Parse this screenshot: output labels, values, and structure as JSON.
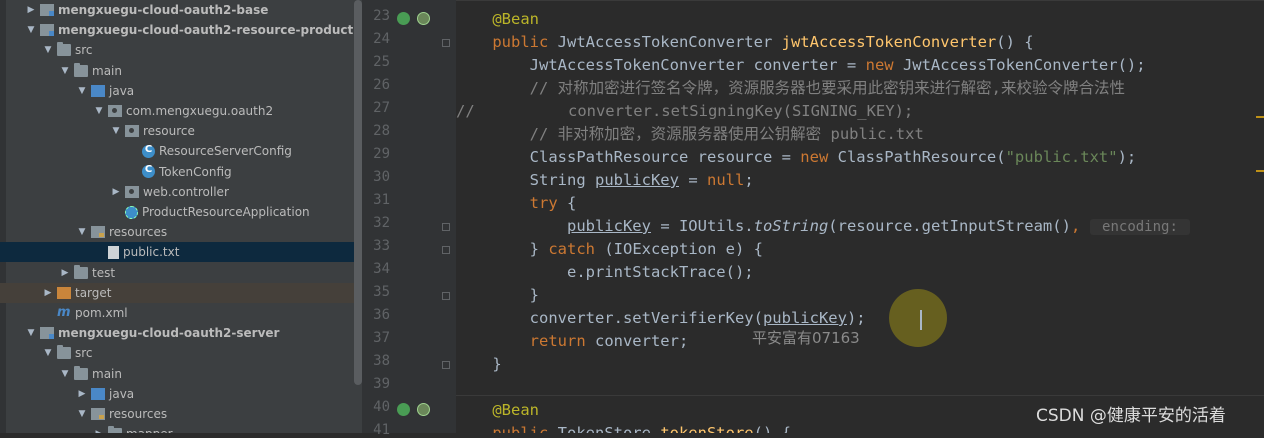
{
  "project_tree": [
    {
      "label": "mengxuegu-cloud-oauth2-base",
      "depth": 0,
      "arrow": "right",
      "icon": "module",
      "bold": true
    },
    {
      "label": "mengxuegu-cloud-oauth2-resource-product",
      "depth": 0,
      "arrow": "down",
      "icon": "module",
      "bold": true
    },
    {
      "label": "src",
      "depth": 1,
      "arrow": "down",
      "icon": "folder"
    },
    {
      "label": "main",
      "depth": 2,
      "arrow": "down",
      "icon": "folder"
    },
    {
      "label": "java",
      "depth": 3,
      "arrow": "down",
      "icon": "folder-src"
    },
    {
      "label": "com.mengxuegu.oauth2",
      "depth": 4,
      "arrow": "down",
      "icon": "package"
    },
    {
      "label": "resource",
      "depth": 5,
      "arrow": "down",
      "icon": "package"
    },
    {
      "label": "ResourceServerConfig",
      "depth": 6,
      "arrow": "",
      "icon": "cls"
    },
    {
      "label": "TokenConfig",
      "depth": 6,
      "arrow": "",
      "icon": "cls"
    },
    {
      "label": "web.controller",
      "depth": 5,
      "arrow": "right",
      "icon": "package"
    },
    {
      "label": "ProductResourceApplication",
      "depth": 5,
      "arrow": "",
      "icon": "app"
    },
    {
      "label": "resources",
      "depth": 3,
      "arrow": "down",
      "icon": "folder-res"
    },
    {
      "label": "public.txt",
      "depth": 4,
      "arrow": "",
      "icon": "txt",
      "selected": true
    },
    {
      "label": "test",
      "depth": 2,
      "arrow": "right",
      "icon": "folder"
    },
    {
      "label": "target",
      "depth": 1,
      "arrow": "right",
      "icon": "folder-target",
      "excluded": true
    },
    {
      "label": "pom.xml",
      "depth": 1,
      "arrow": "",
      "icon": "maven"
    },
    {
      "label": "mengxuegu-cloud-oauth2-server",
      "depth": 0,
      "arrow": "down",
      "icon": "module",
      "bold": true
    },
    {
      "label": "src",
      "depth": 1,
      "arrow": "down",
      "icon": "folder"
    },
    {
      "label": "main",
      "depth": 2,
      "arrow": "down",
      "icon": "folder"
    },
    {
      "label": "java",
      "depth": 3,
      "arrow": "right",
      "icon": "folder-src"
    },
    {
      "label": "resources",
      "depth": 3,
      "arrow": "down",
      "icon": "folder-res"
    },
    {
      "label": "mapper",
      "depth": 4,
      "arrow": "right",
      "icon": "folder"
    }
  ],
  "line_numbers": [
    "23",
    "24",
    "25",
    "26",
    "27",
    "28",
    "29",
    "30",
    "31",
    "32",
    "33",
    "34",
    "35",
    "36",
    "37",
    "38",
    "39",
    "40",
    "41"
  ],
  "code_lines": [
    [
      {
        "t": "    "
      },
      {
        "t": "@Bean",
        "c": "ann"
      }
    ],
    [
      {
        "t": "    "
      },
      {
        "t": "public ",
        "c": "kw"
      },
      {
        "t": "JwtAccessTokenConverter "
      },
      {
        "t": "jwtAccessTokenConverter",
        "c": "fn"
      },
      {
        "t": "() {"
      }
    ],
    [
      {
        "t": "        JwtAccessTokenConverter converter = "
      },
      {
        "t": "new ",
        "c": "kw"
      },
      {
        "t": "JwtAccessTokenConverter();"
      }
    ],
    [
      {
        "t": "        "
      },
      {
        "t": "// 对称加密进行签名令牌，资源服务器也要采用此密钥来进行解密,来校验令牌合法性",
        "c": "cm"
      }
    ],
    [
      {
        "t": "//          converter.setSigningKey(SIGNING_KEY);",
        "c": "cm"
      }
    ],
    [
      {
        "t": "        "
      },
      {
        "t": "// 非对称加密，资源服务器使用公钥解密 public.txt",
        "c": "cm"
      }
    ],
    [
      {
        "t": "        ClassPathResource resource = "
      },
      {
        "t": "new ",
        "c": "kw"
      },
      {
        "t": "ClassPathResource("
      },
      {
        "t": "\"public.txt\"",
        "c": "str"
      },
      {
        "t": ");"
      }
    ],
    [
      {
        "t": "        String "
      },
      {
        "t": "publicKey",
        "c": "ul"
      },
      {
        "t": " = "
      },
      {
        "t": "null",
        "c": "kw"
      },
      {
        "t": ";"
      }
    ],
    [
      {
        "t": "        "
      },
      {
        "t": "try ",
        "c": "kw"
      },
      {
        "t": "{"
      }
    ],
    [
      {
        "t": "            "
      },
      {
        "t": "publicKey",
        "c": "ul"
      },
      {
        "t": " = IOUtils."
      },
      {
        "t": "toString",
        "c": "it"
      },
      {
        "t": "(resource.getInputStream()"
      },
      {
        "t": ", ",
        "c": "kw"
      },
      {
        "t": " encoding: ",
        "c": "hint"
      }
    ],
    [
      {
        "t": "        } "
      },
      {
        "t": "catch ",
        "c": "kw"
      },
      {
        "t": "(IOException e) {"
      }
    ],
    [
      {
        "t": "            e.printStackTrace();"
      }
    ],
    [
      {
        "t": "        }"
      }
    ],
    [
      {
        "t": "        converter.setVerifierKey("
      },
      {
        "t": "publicKey",
        "c": "ul"
      },
      {
        "t": ");"
      }
    ],
    [
      {
        "t": "        "
      },
      {
        "t": "return ",
        "c": "kw"
      },
      {
        "t": "converter;"
      }
    ],
    [
      {
        "t": "    }"
      }
    ],
    [
      {
        "t": ""
      }
    ],
    [
      {
        "t": "    "
      },
      {
        "t": "@Bean",
        "c": "ann"
      }
    ],
    [
      {
        "t": "    "
      },
      {
        "t": "public ",
        "c": "kw"
      },
      {
        "t": "TokenStore "
      },
      {
        "t": "tokenStore",
        "c": "fn"
      },
      {
        "t": "() {"
      }
    ]
  ],
  "watermark_center": "平安富有07163",
  "watermark_corner": "CSDN @健康平安的活着"
}
